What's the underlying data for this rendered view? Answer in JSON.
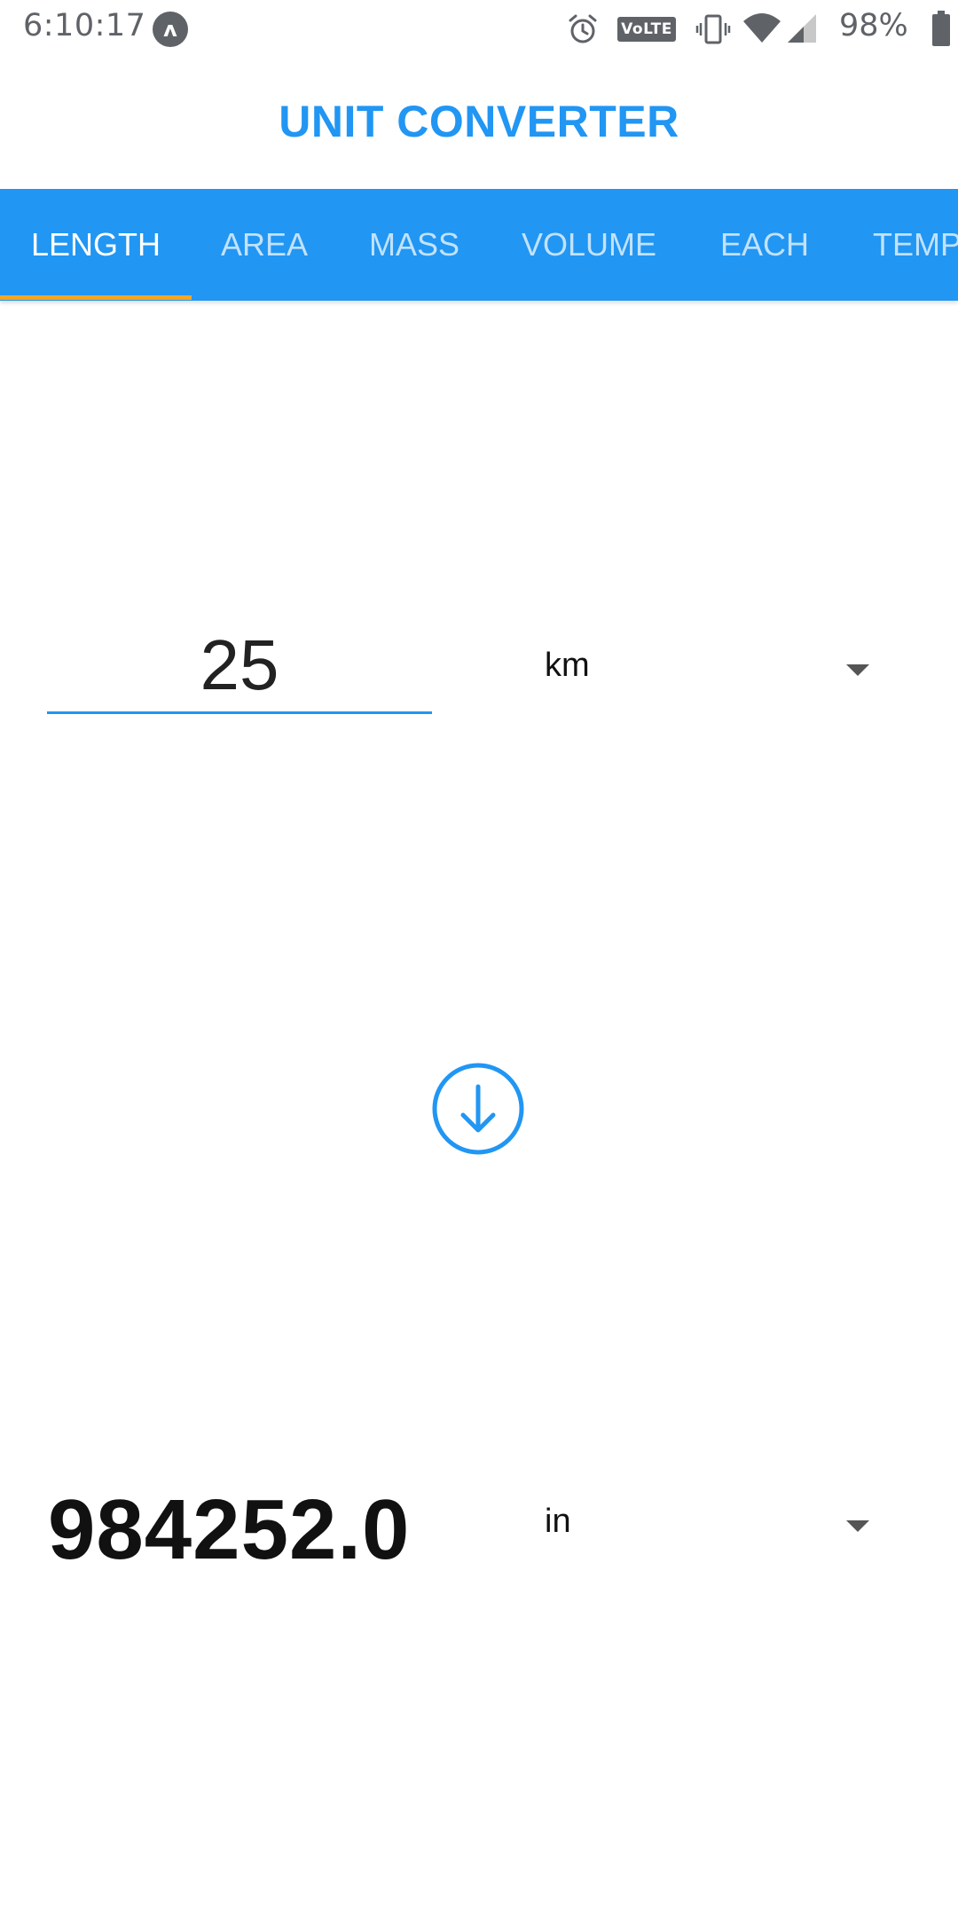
{
  "status_bar": {
    "time": "6:10:17",
    "notification_icon": "arrow-up-icon",
    "volte_badge": "VoLTE",
    "battery_percent": "98%",
    "icons": [
      "alarm-icon",
      "volte-icon",
      "vibrate-icon",
      "wifi-icon",
      "cell-signal-icon",
      "battery-icon"
    ]
  },
  "app": {
    "title": "UNIT CONVERTER",
    "accent_color": "#2196f3",
    "indicator_color": "#f5a623"
  },
  "tabs": [
    {
      "label": "LENGTH",
      "active": true
    },
    {
      "label": "AREA",
      "active": false
    },
    {
      "label": "MASS",
      "active": false
    },
    {
      "label": "VOLUME",
      "active": false
    },
    {
      "label": "EACH",
      "active": false
    },
    {
      "label": "TEMP",
      "active": false
    }
  ],
  "converter": {
    "input_value": "25",
    "from_unit": "km",
    "convert_icon": "arrow-down-circle-icon",
    "result_value": "984252.0",
    "to_unit": "in"
  }
}
